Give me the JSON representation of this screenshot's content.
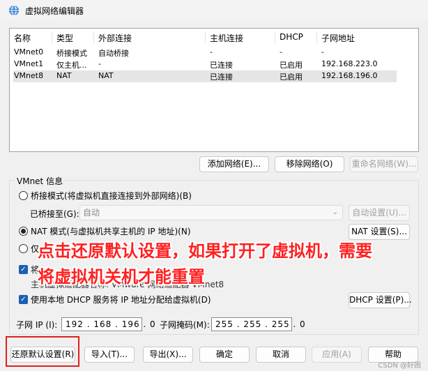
{
  "window": {
    "title": "虚拟网络编辑器",
    "icon": "globe-network-icon"
  },
  "table": {
    "headers": [
      "名称",
      "类型",
      "外部连接",
      "主机连接",
      "DHCP",
      "子网地址"
    ],
    "rows": [
      [
        "VMnet0",
        "桥接模式",
        "自动桥接",
        "-",
        "-",
        "-"
      ],
      [
        "VMnet1",
        "仅主机...",
        "-",
        "已连接",
        "已启用",
        "192.168.223.0"
      ],
      [
        "VMnet8",
        "NAT",
        "NAT",
        "已连接",
        "已启用",
        "192.168.196.0"
      ]
    ],
    "selected_row": 2
  },
  "network_buttons": {
    "add": "添加网络(E)...",
    "remove": "移除网络(O)",
    "rename": "重命名网络(W)..."
  },
  "vmnet_info": {
    "title": "VMnet 信息",
    "bridged": {
      "label": "桥接模式(将虚拟机直接连接到外部网络)(B)",
      "checked": false
    },
    "bridged_to": {
      "label": "已桥接至(G):",
      "value": "自动",
      "auto_settings": "自动设置(U)..."
    },
    "nat": {
      "label": "NAT 模式(与虚拟机共享主机的 IP 地址)(N)",
      "checked": true,
      "settings": "NAT 设置(S)..."
    },
    "host_only": {
      "label": "仅",
      "checked": false
    },
    "connect_adapter": {
      "label": "将",
      "checked": true
    },
    "adapter_name": {
      "label": "主机虚拟适配器名称: VMware 网络适配器 VMnet8"
    },
    "dhcp": {
      "label": "使用本地 DHCP 服务将 IP 地址分配给虚拟机(D)",
      "checked": true,
      "settings": "DHCP 设置(P)..."
    },
    "subnet_ip": {
      "label": "子网 IP (I):",
      "value": "192 . 168 . 196 . 0"
    },
    "subnet_mask": {
      "label": "子网掩码(M):",
      "value": "255 . 255 . 255 . 0"
    }
  },
  "bottom_buttons": {
    "restore": "还原默认设置(R)",
    "import": "导入(T)...",
    "export": "导出(X)...",
    "ok": "确定",
    "cancel": "取消",
    "apply": "应用(A)",
    "help": "帮助"
  },
  "annotation": {
    "line1": "点击还原默认设置，如果打开了虚拟机，需要",
    "line2": "将虚拟机关机才能重置",
    "color": "#ff2020"
  },
  "watermark": "CSDN @好困"
}
